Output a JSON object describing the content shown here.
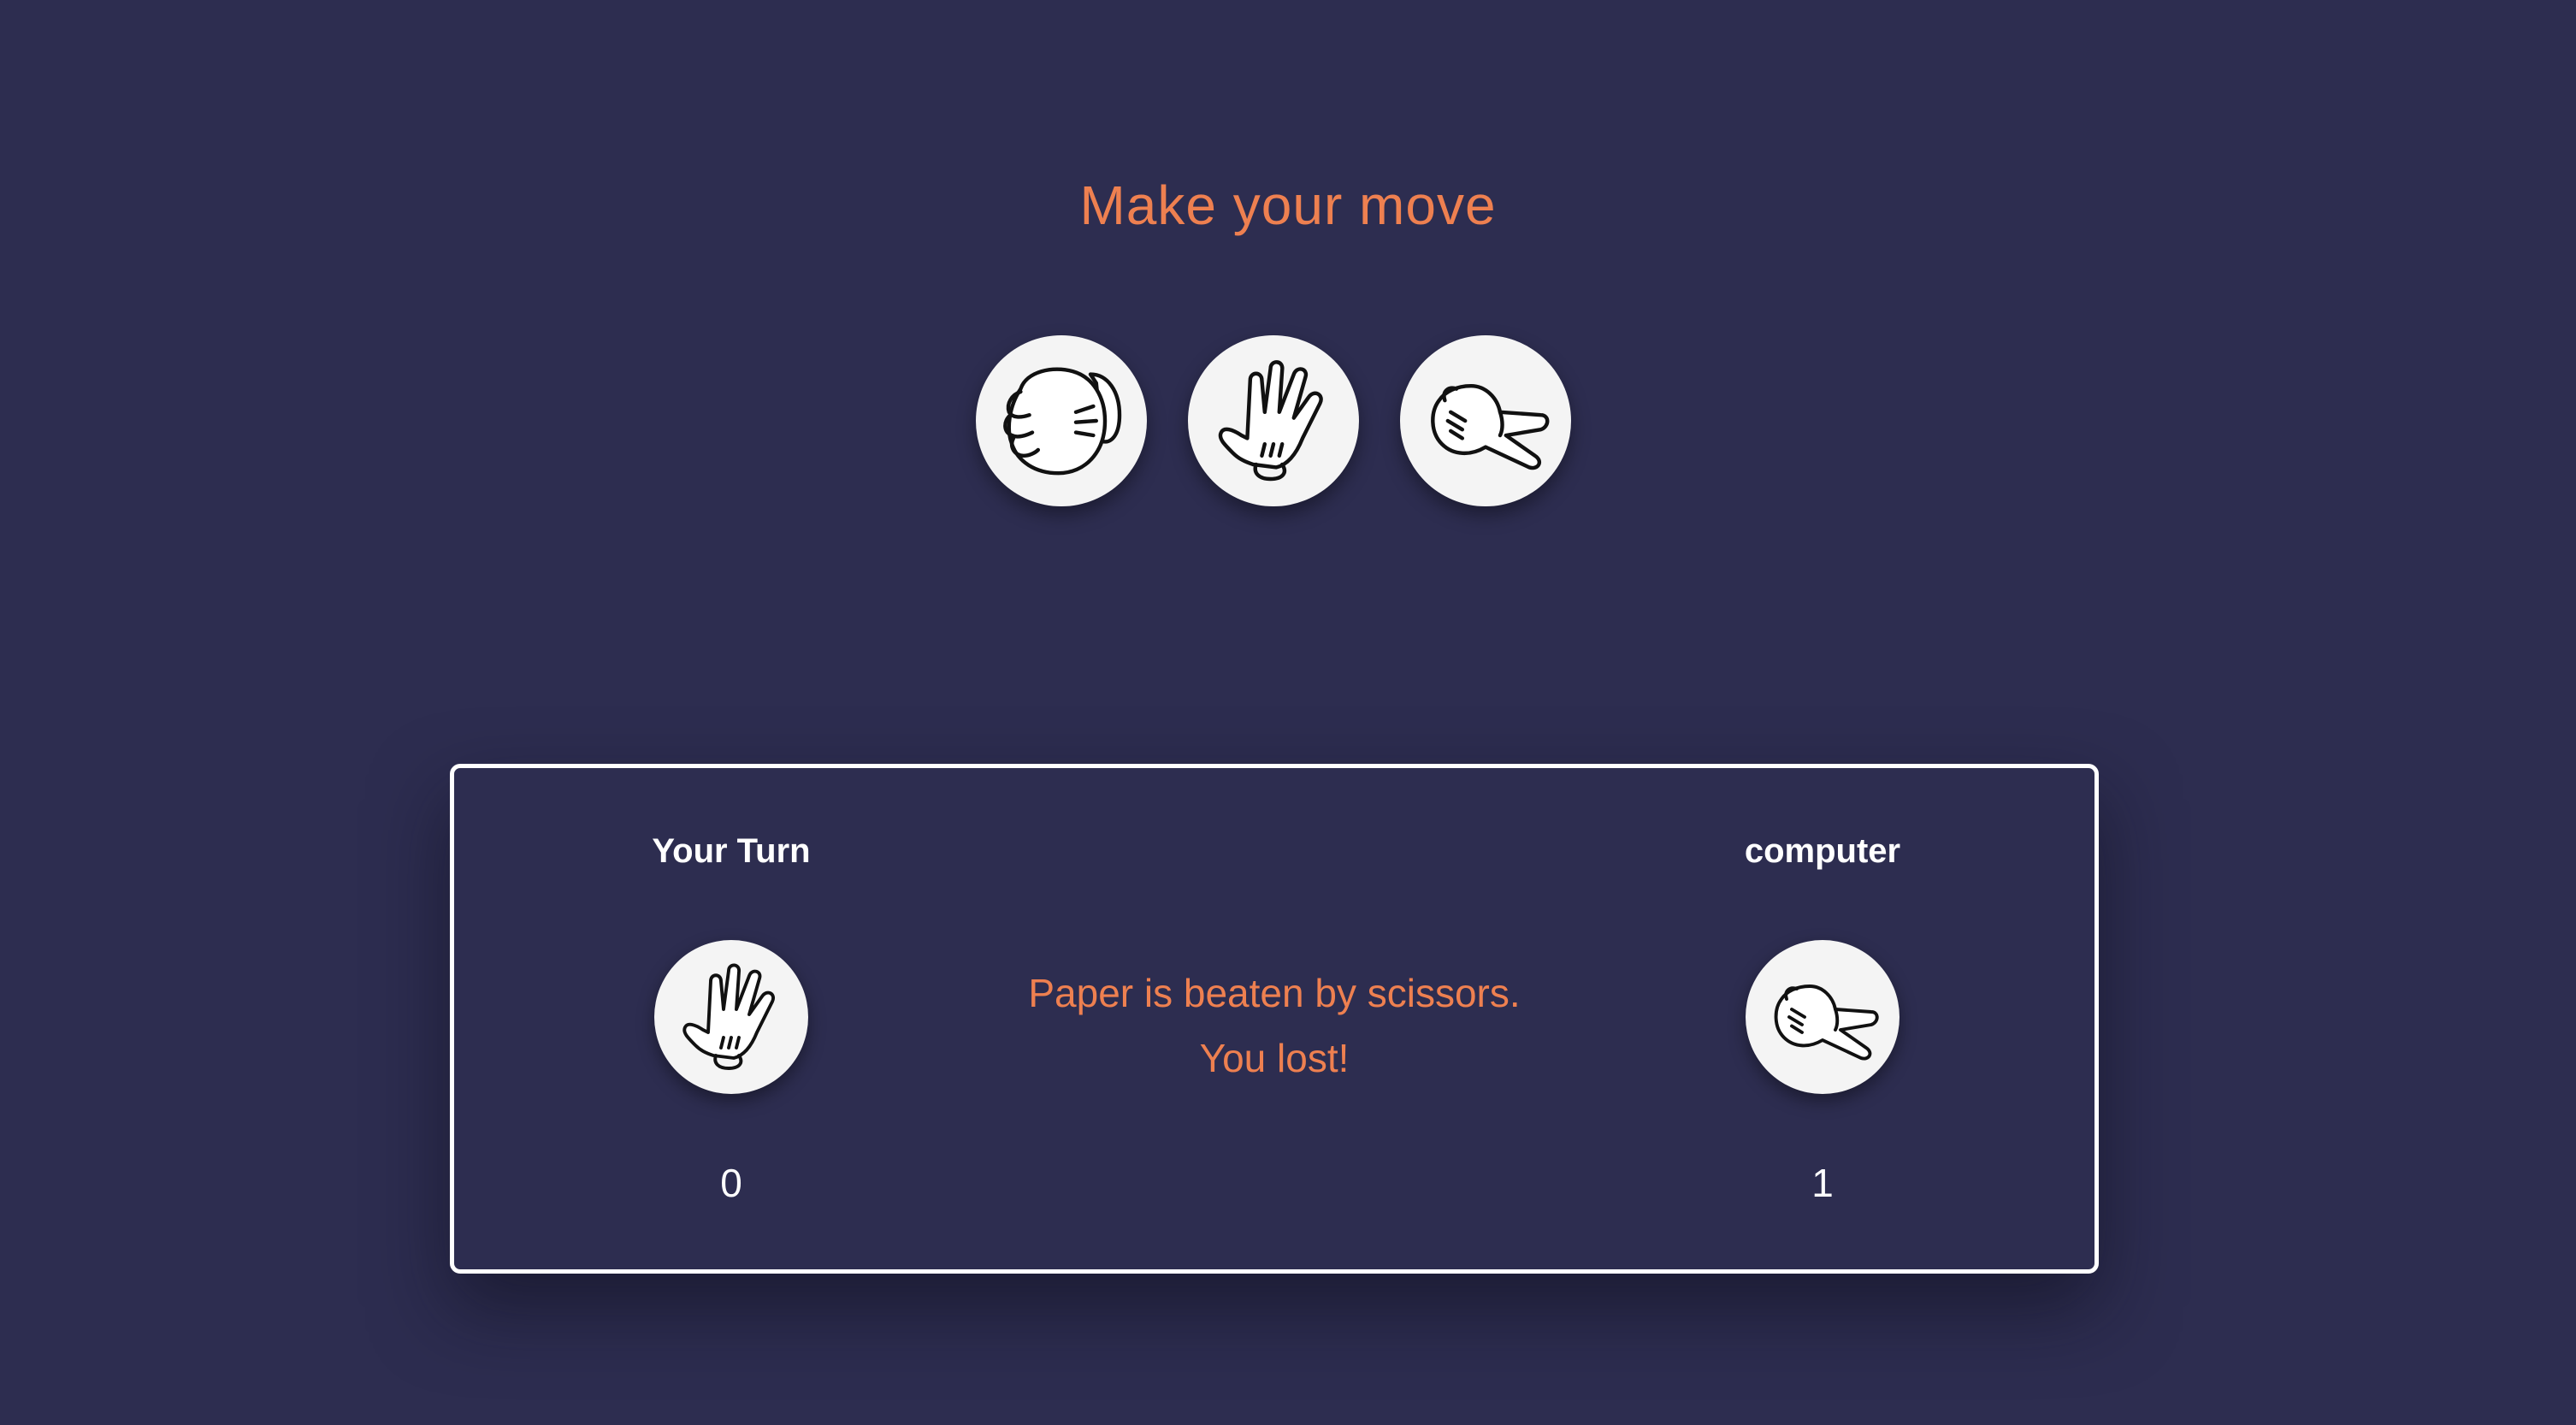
{
  "header": {
    "prompt": "Make your move"
  },
  "choices": [
    {
      "name": "rock",
      "icon": "rock-fist-icon"
    },
    {
      "name": "paper",
      "icon": "paper-hand-icon"
    },
    {
      "name": "scissors",
      "icon": "scissors-hand-icon"
    }
  ],
  "scoreboard": {
    "player": {
      "label": "Your Turn",
      "pick_icon": "paper-hand-icon",
      "score": "0"
    },
    "computer": {
      "label": "computer",
      "pick_icon": "scissors-hand-icon",
      "score": "1"
    },
    "result": {
      "line1": "Paper is beaten by scissors.",
      "line2": "You lost!"
    }
  },
  "colors": {
    "background": "#2d2d50",
    "accent": "#ee8050",
    "text": "#ffffff",
    "choice_bg": "#f4f4f4"
  }
}
